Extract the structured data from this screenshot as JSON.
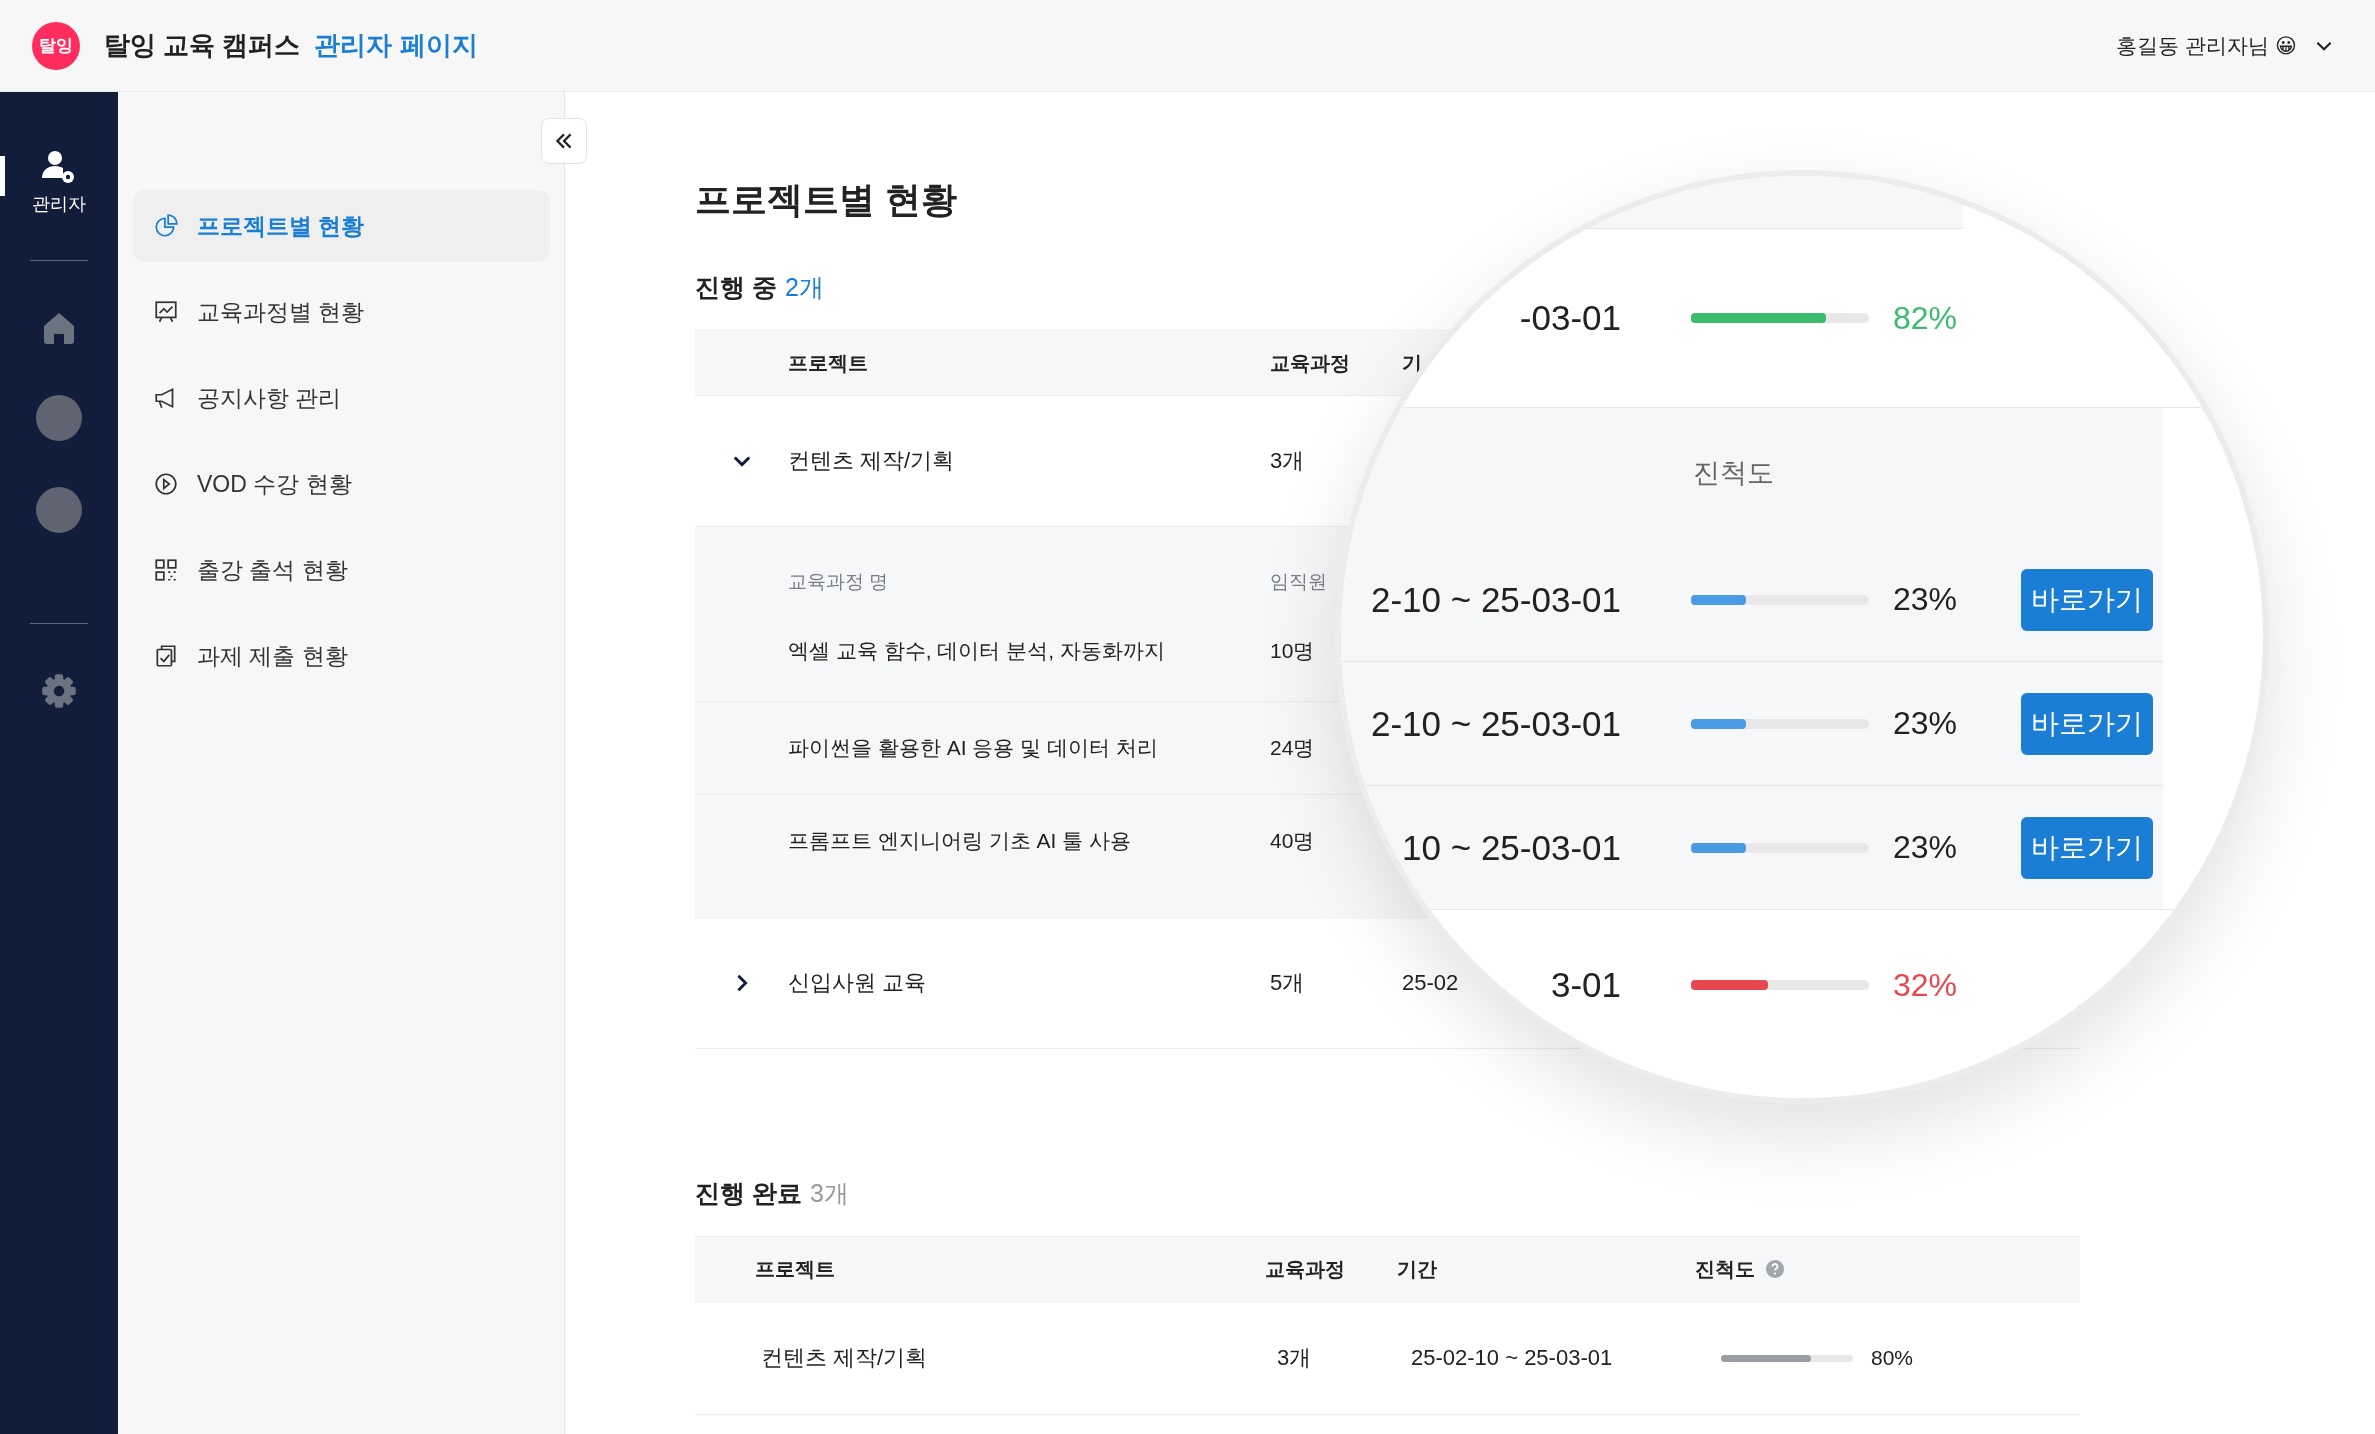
{
  "header": {
    "logo": "탈잉",
    "brand": "탈잉 교육 캠퍼스",
    "section": "관리자 페이지",
    "user": "홍길동 관리자님 😀"
  },
  "rail": [
    {
      "kind": "admin",
      "label": "관리자",
      "selected": true
    },
    {
      "kind": "home",
      "selected": false
    },
    {
      "kind": "photo",
      "selected": false
    },
    {
      "kind": "photo",
      "selected": false
    },
    {
      "kind": "settings",
      "selected": false
    }
  ],
  "sidebar": {
    "items": [
      {
        "kind": "pie",
        "label": "프로젝트별 현황",
        "selected": true
      },
      {
        "kind": "chart",
        "label": "교육과정별 현황",
        "selected": false
      },
      {
        "kind": "megaphone",
        "label": "공지사항 관리",
        "selected": false
      },
      {
        "kind": "play",
        "label": "VOD 수강 현황",
        "selected": false
      },
      {
        "kind": "qr",
        "label": "출강 출석 현황",
        "selected": false
      },
      {
        "kind": "clipboard",
        "label": "과제 제출 현황",
        "selected": false
      }
    ]
  },
  "page_title": "프로젝트별 현황",
  "in_progress": {
    "label": "진행 중",
    "count": "2개",
    "columns": [
      "프로젝트",
      "교육과정",
      "기"
    ],
    "projects": [
      {
        "name": "컨텐츠 제작/기획",
        "count": "3개",
        "expanded": true,
        "subheader": [
          "교육과정 명",
          "임직원"
        ],
        "children": [
          {
            "name": "엑셀 교육 함수, 데이터 분석, 자동화까지",
            "count": "10명"
          },
          {
            "name": "파이썬을 활용한 AI 응용 및 데이터 처리",
            "count": "24명"
          },
          {
            "name": "프롬프트 엔지니어링 기초 AI 툴 사용",
            "count": "40명"
          }
        ]
      },
      {
        "name": "신입사원 교육",
        "count": "5개",
        "expanded": false,
        "period": "25-02"
      }
    ]
  },
  "magnifier": {
    "rows": [
      {
        "kind": "project",
        "period": "-03-01",
        "level": 0.76,
        "color": "#3dbb6e",
        "reading": "82%"
      },
      {
        "kind": "subheader",
        "label": "진척도"
      },
      {
        "kind": "course",
        "period": "2-10 ~ 25-03-01",
        "level": 0.31,
        "color": "#4a9be3",
        "reading": "23%",
        "button": "바로가기"
      },
      {
        "kind": "course",
        "period": "2-10 ~ 25-03-01",
        "level": 0.31,
        "color": "#4a9be3",
        "reading": "23%",
        "button": "바로가기"
      },
      {
        "kind": "course",
        "period": "10 ~ 25-03-01",
        "level": 0.31,
        "color": "#4a9be3",
        "reading": "23%",
        "button": "바로가기"
      },
      {
        "kind": "project",
        "period": "3-01",
        "level": 0.43,
        "color": "#e8474f",
        "reading": "32%"
      }
    ]
  },
  "completed": {
    "label": "진행 완료",
    "count": "3개",
    "columns": [
      "프로젝트",
      "교육과정",
      "기간",
      "진척도"
    ],
    "rows": [
      {
        "name": "컨텐츠 제작/기획",
        "count": "3개",
        "period": "25-02-10 ~ 25-03-01",
        "level": 0.68,
        "reading": "80%"
      }
    ]
  }
}
